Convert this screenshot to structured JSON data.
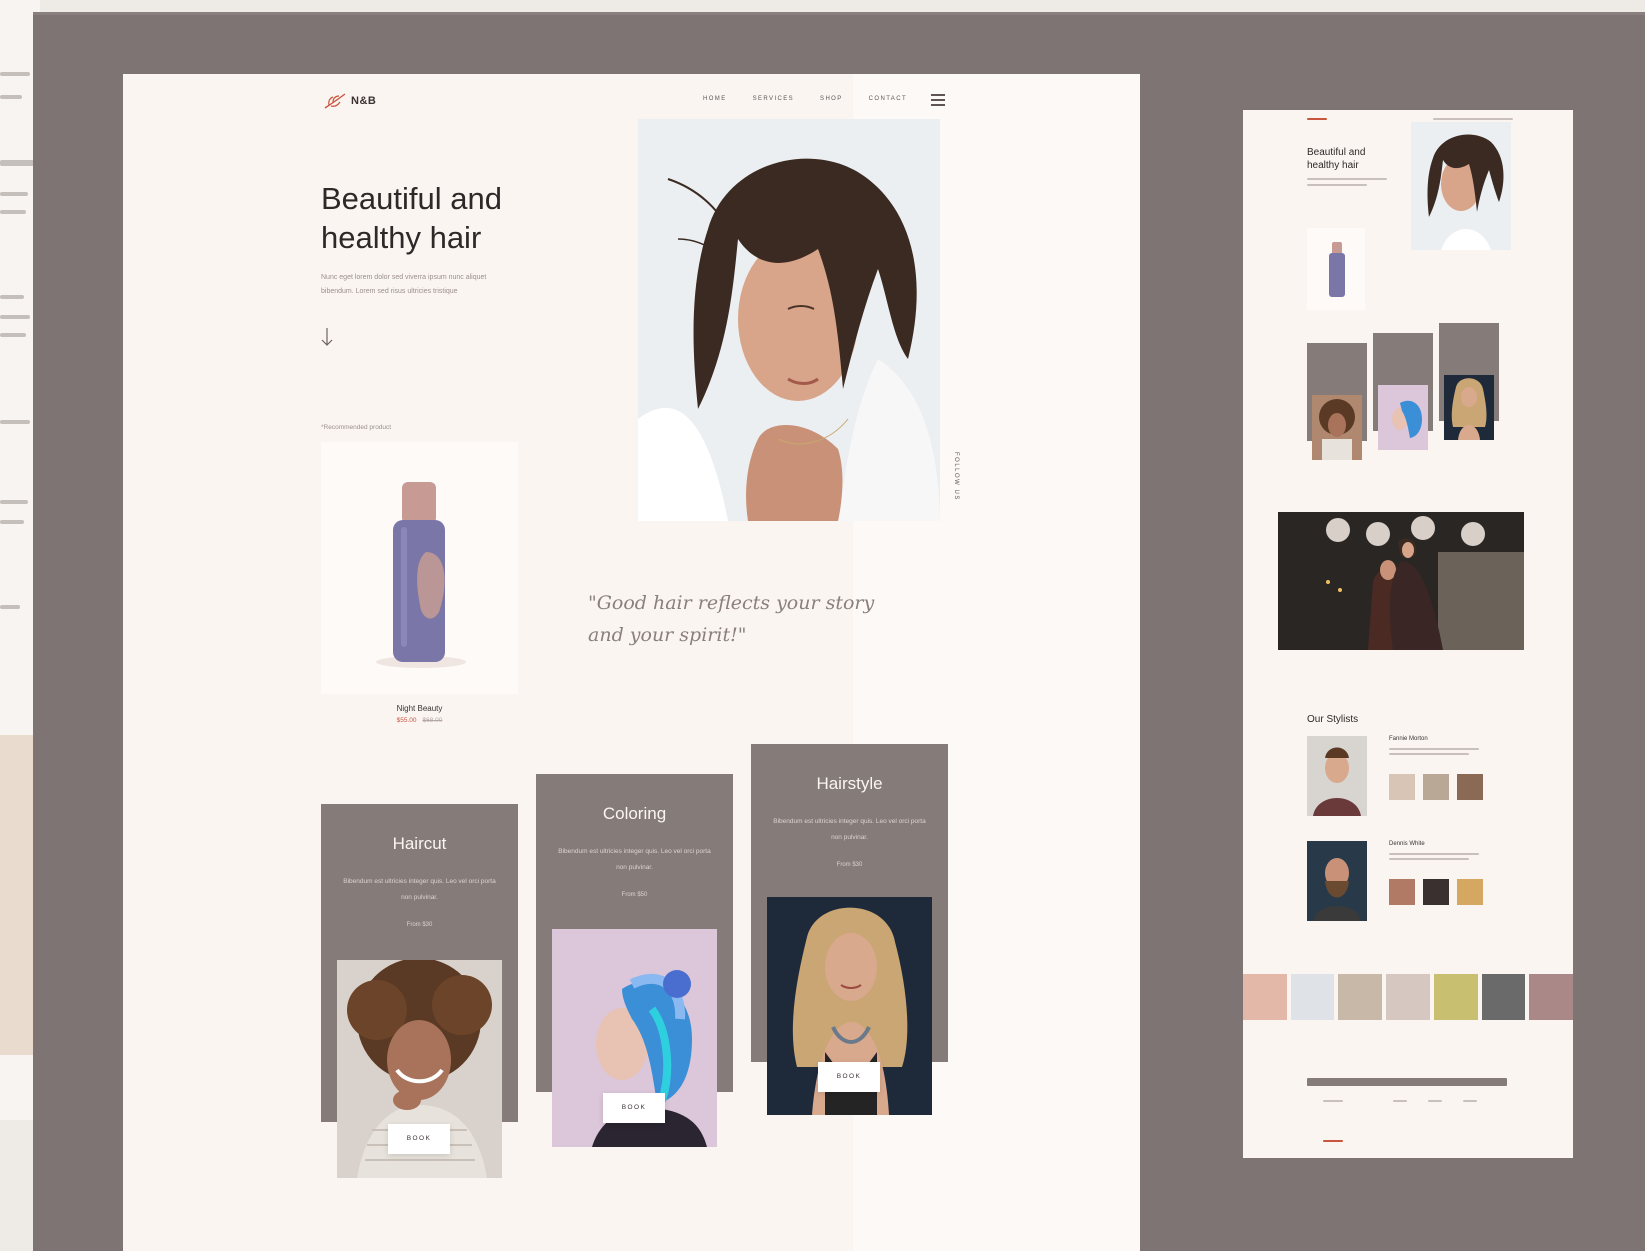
{
  "brand": {
    "name": "N&B",
    "accent": "#c8553d",
    "panel": "#857b79",
    "background": "#7e7473",
    "page": "#fbf5f2"
  },
  "nav": {
    "items": [
      "HOME",
      "SERVICES",
      "SHOP",
      "CONTACT"
    ],
    "menu_icon": "hamburger-menu-icon"
  },
  "hero": {
    "title_line1": "Beautiful and",
    "title_line2": "healthy hair",
    "text_line1": "Nunc eget lorem dolor sed viverra ipsum nunc aliquet",
    "text_line2": "bibendum. Lorem sed risus ultricies tristique",
    "scroll_icon": "arrow-down-icon",
    "follow_label": "FOLLOW US"
  },
  "product": {
    "label": "*Recommended product",
    "name": "Night Beauty",
    "price": "$55.00",
    "old_price": "$68.00"
  },
  "quote": {
    "line1": "\"Good hair reflects your story",
    "line2": "and your spirit!\""
  },
  "services": [
    {
      "title": "Haircut",
      "text": "Bibendum est ultricies integer quis. Leo vel orci porta non pulvinar.",
      "price": "From $30",
      "button": "BOOK"
    },
    {
      "title": "Coloring",
      "text": "Bibendum est ultricies integer quis. Leo vel orci porta non pulvinar.",
      "price": "From $50",
      "button": "BOOK"
    },
    {
      "title": "Hairstyle",
      "text": "Bibendum est ultricies integer quis. Leo vel orci porta non pulvinar.",
      "price": "From $30",
      "button": "BOOK"
    }
  ],
  "mobile": {
    "title_line1": "Beautiful and",
    "title_line2": "healthy hair",
    "stylists_heading": "Our Stylists",
    "stylists": [
      {
        "name": "Fannie Morton"
      },
      {
        "name": "Dennis White"
      }
    ]
  }
}
